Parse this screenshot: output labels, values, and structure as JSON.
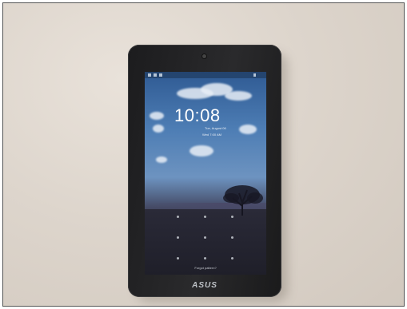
{
  "lock_screen": {
    "time": "10:08",
    "date": "Tue, August 06",
    "next_alarm": "Wed 7:00 AM",
    "unlock_hint": "Forgot pattern?"
  },
  "device": {
    "brand": "ASUS"
  },
  "icons": [
    "camera-icon",
    "status-notification-icon",
    "battery-icon",
    "pattern-dot-icon"
  ],
  "colors": {
    "sky": "#4d7db4",
    "bezel": "#1c1c1e",
    "wall": "#ddd5cc"
  }
}
